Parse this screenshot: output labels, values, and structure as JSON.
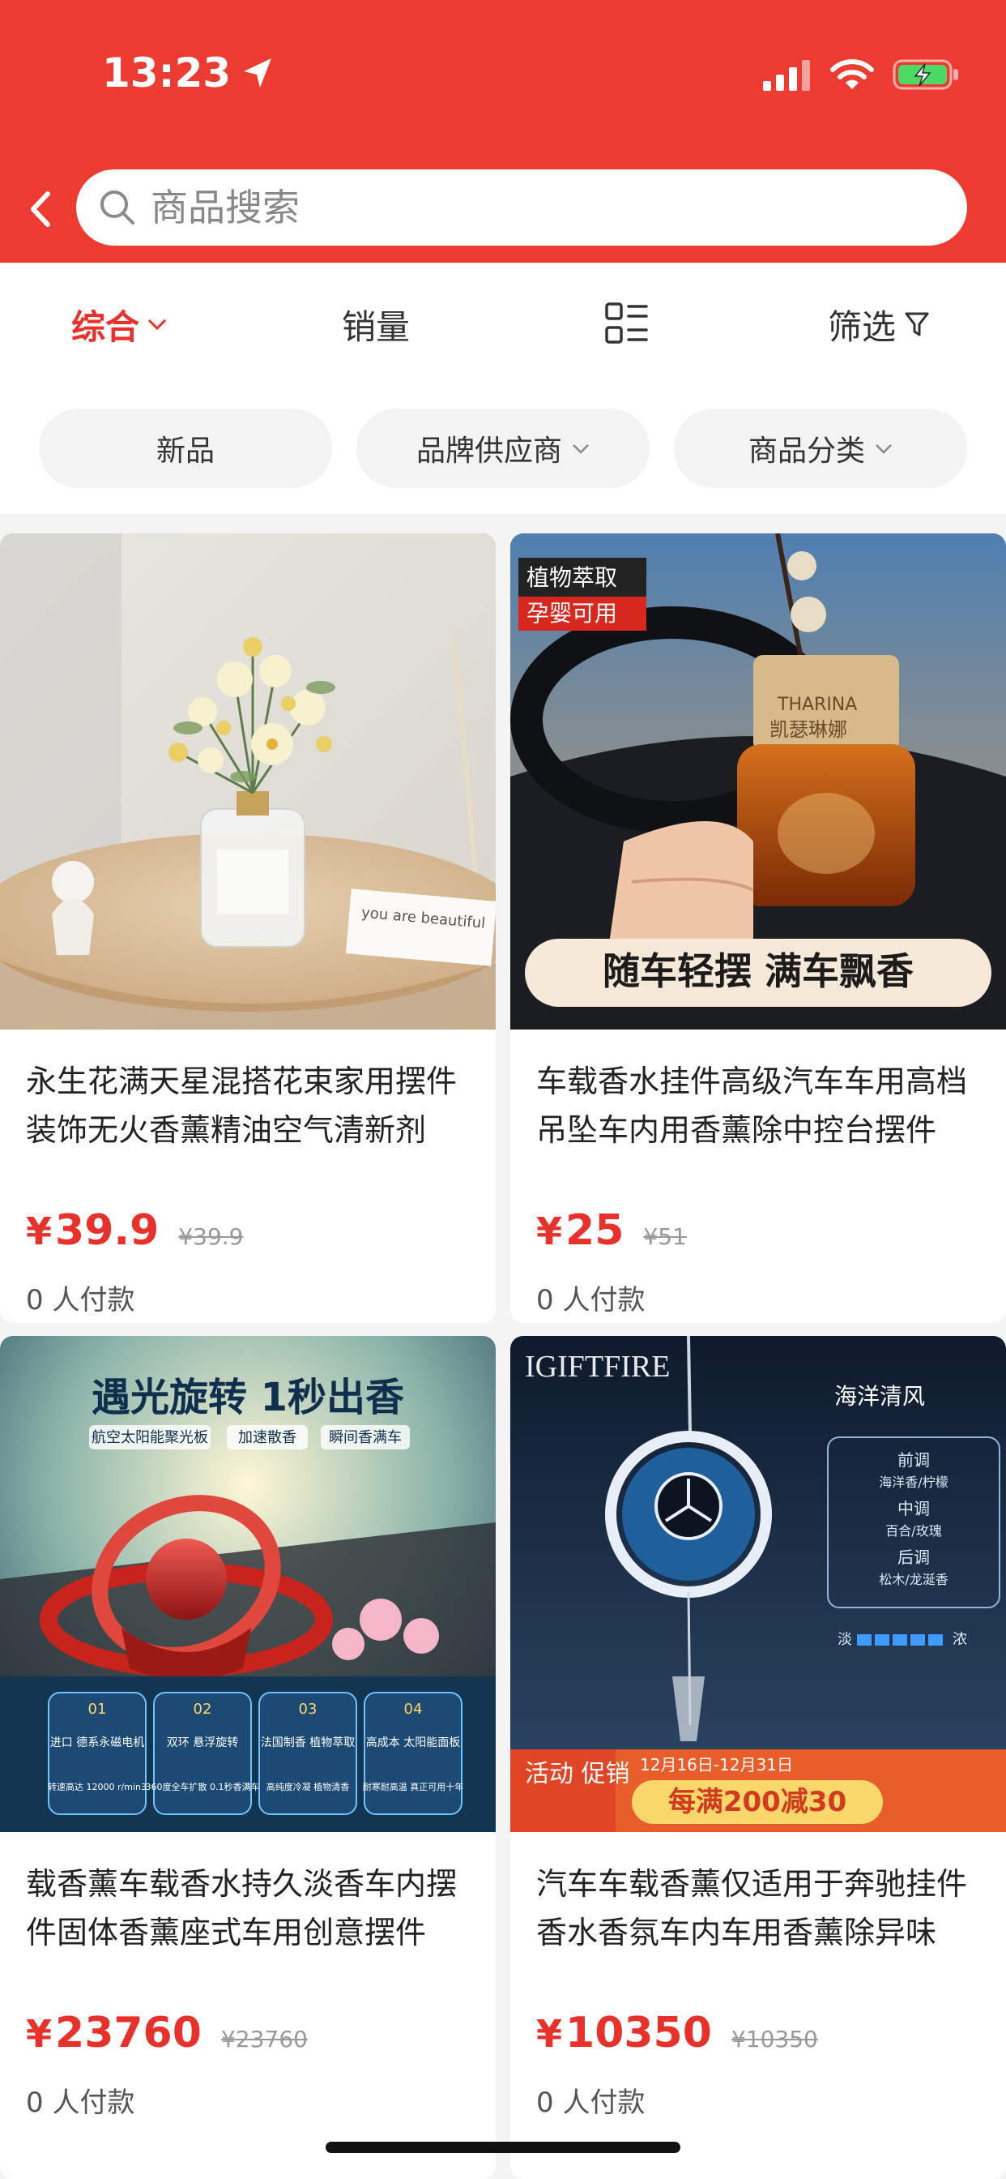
{
  "status_bar": {
    "time": "13:23"
  },
  "search": {
    "placeholder": "商品搜索"
  },
  "sort_tabs": {
    "comprehensive": "综合",
    "sales": "销量",
    "filter": "筛选"
  },
  "filter_chips": {
    "new": "新品",
    "brand": "品牌供应商",
    "category": "商品分类"
  },
  "products": [
    {
      "title": "永生花满天星混搭花束家用摆件装饰无火香薰精油空气清新剂",
      "currency": "¥",
      "price": "39.9",
      "original_price": "¥39.9",
      "paid_count": "0 人付款",
      "image_text": {
        "card_text": "you are beautiful"
      }
    },
    {
      "title": "车载香水挂件高级汽车车用高档吊坠车内用香薰除中控台摆件",
      "currency": "¥",
      "price": "25",
      "original_price": "¥51",
      "paid_count": "0 人付款",
      "image_text": {
        "badge_top": "植物萃取",
        "badge_bottom": "孕婴可用",
        "banner": "随车轻摆 满车飘香",
        "brand_cn": "凯瑟琳娜",
        "brand_en": "THARINA"
      }
    },
    {
      "title": "载香薰车载香水持久淡香车内摆件固体香薰座式车用创意摆件",
      "currency": "¥",
      "price": "23760",
      "original_price": "¥23760",
      "paid_count": "0 人付款",
      "image_text": {
        "headline": "遇光旋转 1秒出香",
        "tags": [
          "航空太阳能聚光板",
          "加速散香",
          "瞬间香满车"
        ],
        "features": [
          {
            "num": "01",
            "title": "进口\n德系永磁电机",
            "desc": "转速高达\n12000 r/min3"
          },
          {
            "num": "02",
            "title": "双环\n悬浮旋转",
            "desc": "360度全车扩散\n0.1秒香满车"
          },
          {
            "num": "03",
            "title": "法国制香\n植物萃取",
            "desc": "高纯度冷凝\n植物清香"
          },
          {
            "num": "04",
            "title": "高成本\n太阳能面板",
            "desc": "耐寒耐高温\n真正可用十年"
          }
        ]
      }
    },
    {
      "title": "汽车车载香薰仅适用于奔驰挂件香水香氛车内车用香薰除异味",
      "currency": "¥",
      "price": "10350",
      "original_price": "¥10350",
      "paid_count": "0 人付款",
      "image_text": {
        "brand": "IGIFTFIRE",
        "scent_name": "海洋清风",
        "notes": [
          {
            "label": "前调",
            "value": "海洋香/柠檬"
          },
          {
            "label": "中调",
            "value": "百合/玫瑰"
          },
          {
            "label": "后调",
            "value": "松木/龙涎香"
          }
        ],
        "scale_light": "淡",
        "scale_strong": "浓",
        "promo_tag": "活动\n促销",
        "promo_dates": "12月16日-12月31日",
        "promo_text": "每满200减30"
      }
    }
  ],
  "colors": {
    "brand_red": "#ee3b31",
    "price_red": "#e8312a"
  }
}
